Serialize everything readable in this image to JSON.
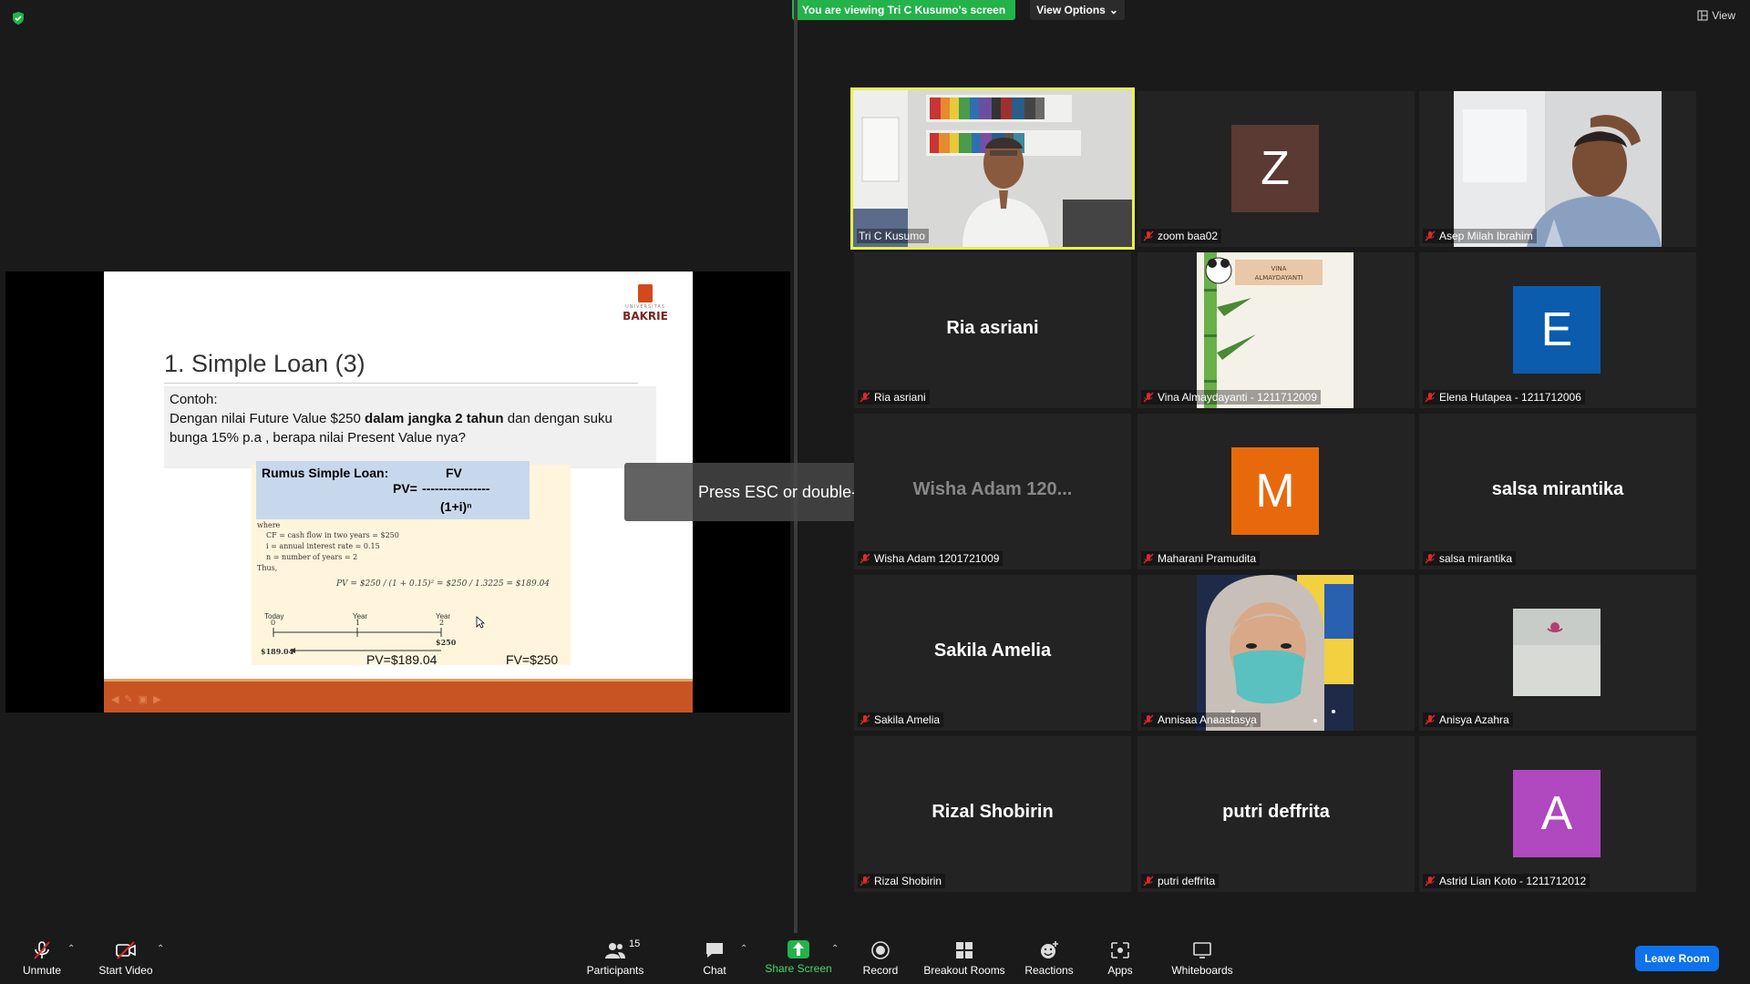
{
  "header": {
    "viewing_banner": "You are viewing Tri C Kusumo's screen",
    "view_options": "View Options",
    "view_label": "View"
  },
  "toast": {
    "fullscreen_msg": "Press ESC or double-click to exit full screen mode"
  },
  "slide": {
    "logo_uni": "UNIVERSITAS",
    "logo_name": "BAKRIE",
    "title": "1. Simple Loan (3)",
    "contoh": "Contoh:",
    "line1_a": "Dengan nilai  Future  Value $250 ",
    "line1_b": "dalam jangka 2 tahun",
    "line1_c": " dan  dengan suku",
    "line2": "bunga 15% p.a , berapa nilai Present Value nya?",
    "formula_title": "Rumus  Simple Loan:",
    "formula_fv": "FV",
    "formula_pv": "PV=",
    "formula_line": "----------------",
    "formula_den": "(1+i)ⁿ",
    "where": "where",
    "def_cf": "CF = cash flow in two years = $250",
    "def_i": "i    = annual interest rate     = 0.15",
    "def_n": "n   = number of years           = 2",
    "thus": "Thus,",
    "pv_calc": "PV = $250 / (1 + 0.15)² = $250 / 1.3225 = $189.04",
    "t_today": "Today",
    "t_0": "0",
    "t_year1": "Year",
    "t_1": "1",
    "t_year2": "Year",
    "t_2": "2",
    "t_189": "$189.04",
    "t_250": "$250",
    "pv_label": "PV=$189.04",
    "fv_label": "FV=$250"
  },
  "participants": [
    {
      "name": "Tri C Kusumo",
      "type": "video",
      "active": true,
      "muted": false
    },
    {
      "name": "zoom baa02",
      "type": "avatar",
      "initial": "Z",
      "color": "#5a3a32",
      "muted": true
    },
    {
      "name": "Asep Milah Ibrahim",
      "type": "video",
      "muted": true
    },
    {
      "name": "Ria asriani",
      "type": "name",
      "muted": true
    },
    {
      "name": "Vina Almaydayanti - 1211712009",
      "type": "video",
      "badge": "VINA ALMAYDAYANTI",
      "muted": true
    },
    {
      "name": "Elena Hutapea - 1211712006",
      "type": "avatar",
      "initial": "E",
      "color": "#0b5cad",
      "muted": true
    },
    {
      "name": "Wisha Adam 1201721009",
      "type": "name",
      "big": "Wisha Adam 120...",
      "muted": true
    },
    {
      "name": "Maharani Pramudita",
      "type": "avatar",
      "initial": "M",
      "color": "#e8690c",
      "muted": true
    },
    {
      "name": "salsa mirantika",
      "type": "name",
      "muted": true
    },
    {
      "name": "Sakila Amelia",
      "type": "name",
      "muted": true
    },
    {
      "name": "Annisaa Anaastasya",
      "type": "video",
      "muted": true
    },
    {
      "name": "Anisya Azahra",
      "type": "video",
      "muted": true
    },
    {
      "name": "Rizal Shobirin",
      "type": "name",
      "muted": true
    },
    {
      "name": "putri deffrita",
      "type": "name",
      "muted": true
    },
    {
      "name": "Astrid Lian Koto - 1211712012",
      "type": "avatar",
      "initial": "A",
      "color": "#b048c0",
      "muted": true
    }
  ],
  "toolbar": {
    "unmute": "Unmute",
    "start_video": "Start Video",
    "participants": "Participants",
    "participants_count": "15",
    "chat": "Chat",
    "share_screen": "Share Screen",
    "record": "Record",
    "breakout_rooms": "Breakout Rooms",
    "reactions": "Reactions",
    "apps": "Apps",
    "whiteboards": "Whiteboards",
    "leave_room": "Leave Room"
  },
  "colors": {
    "active_border": "#e9f24a",
    "share_green": "#23b34a",
    "leave_blue": "#0e72ed",
    "slide_bar": "#c85424"
  }
}
